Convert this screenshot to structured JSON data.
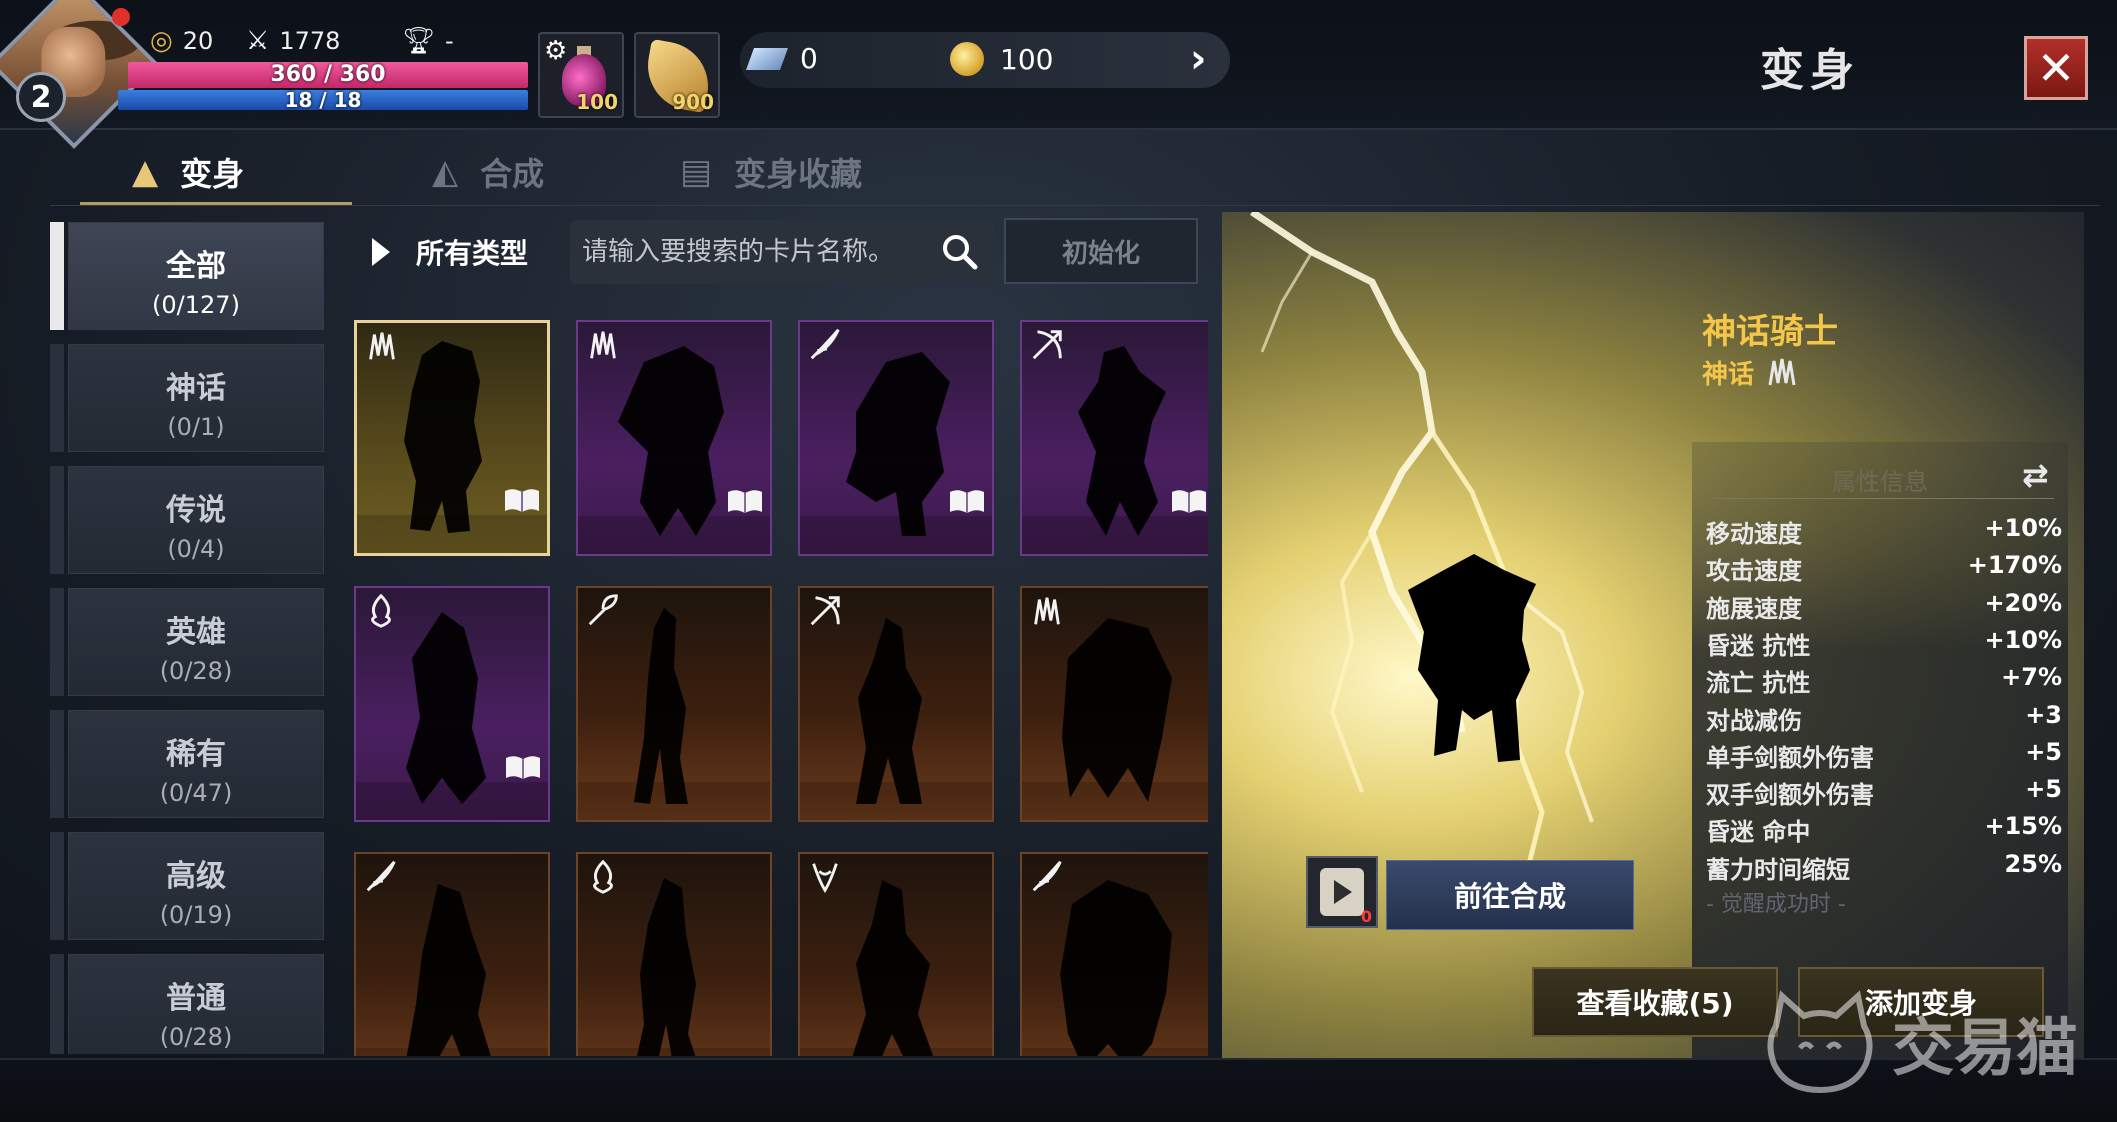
{
  "player": {
    "level": "2",
    "currency_a": "20",
    "combat_power": "1778",
    "trophy": "-",
    "hp": "360 / 360",
    "mp": "18 / 18"
  },
  "quick_items": [
    {
      "name": "potion-icon",
      "count": "100"
    },
    {
      "name": "leaf-icon",
      "count": "900"
    }
  ],
  "currencies": {
    "diamond": "0",
    "gold": "100"
  },
  "header": {
    "title": "变身",
    "close_label": "✕"
  },
  "tabs": [
    {
      "label": "变身",
      "active": true
    },
    {
      "label": "合成",
      "active": false
    },
    {
      "label": "变身收藏",
      "active": false
    }
  ],
  "categories": [
    {
      "name": "全部",
      "count": "(0/127)",
      "active": true
    },
    {
      "name": "神话",
      "count": "(0/1)"
    },
    {
      "name": "传说",
      "count": "(0/4)"
    },
    {
      "name": "英雄",
      "count": "(0/28)"
    },
    {
      "name": "稀有",
      "count": "(0/47)"
    },
    {
      "name": "高级",
      "count": "(0/19)"
    },
    {
      "name": "普通",
      "count": "(0/28)"
    }
  ],
  "filter": {
    "type_label": "所有类型",
    "search_placeholder": "请输入要搜索的卡片名称。",
    "reset_label": "初始化"
  },
  "cards_grid": [
    {
      "theme": "gold",
      "class": "claw-icon",
      "book": true
    },
    {
      "theme": "purple",
      "class": "claw-icon",
      "book": true
    },
    {
      "theme": "purple",
      "class": "feather-icon",
      "book": true
    },
    {
      "theme": "purple",
      "class": "bow-icon",
      "book": true
    },
    {
      "theme": "purple",
      "class": "flame-icon",
      "book": true
    },
    {
      "theme": "orange",
      "class": "sickle-icon",
      "book": false
    },
    {
      "theme": "orange",
      "class": "bow-icon",
      "book": false
    },
    {
      "theme": "orange",
      "class": "claw-icon",
      "book": false
    },
    {
      "theme": "orange",
      "class": "feather-icon",
      "book": false
    },
    {
      "theme": "orange",
      "class": "flame-icon",
      "book": false
    },
    {
      "theme": "orange",
      "class": "horns-icon",
      "book": false
    },
    {
      "theme": "orange",
      "class": "feather-icon",
      "book": false
    }
  ],
  "selected": {
    "name": "神话骑士",
    "rarity": "神话",
    "stats_header": "属性信息",
    "stats": [
      {
        "k": "移动速度",
        "v": "+10%"
      },
      {
        "k": "攻击速度",
        "v": "+170%"
      },
      {
        "k": "施展速度",
        "v": "+20%"
      },
      {
        "k": "昏迷 抗性",
        "v": "+10%"
      },
      {
        "k": "流亡 抗性",
        "v": "+7%"
      },
      {
        "k": "对战减伤",
        "v": "+3"
      },
      {
        "k": "单手剑额外伤害",
        "v": "+5"
      },
      {
        "k": "双手剑额外伤害",
        "v": "+5"
      },
      {
        "k": "昏迷 命中",
        "v": "+15%"
      },
      {
        "k": "蓄力时间缩短",
        "v": "25%"
      }
    ],
    "awaken_label": "- 觉醒成功时 -",
    "synth_item_count": "0",
    "goto_synth_label": "前往合成",
    "view_collection_label": "查看收藏(5)",
    "add_transform_label": "添加变身"
  },
  "watermark": "交易猫",
  "colors": {
    "accent_gold": "#f4c64a",
    "hp": "#e8367f",
    "mp": "#2e6ad0",
    "close_red": "#a5261f"
  }
}
